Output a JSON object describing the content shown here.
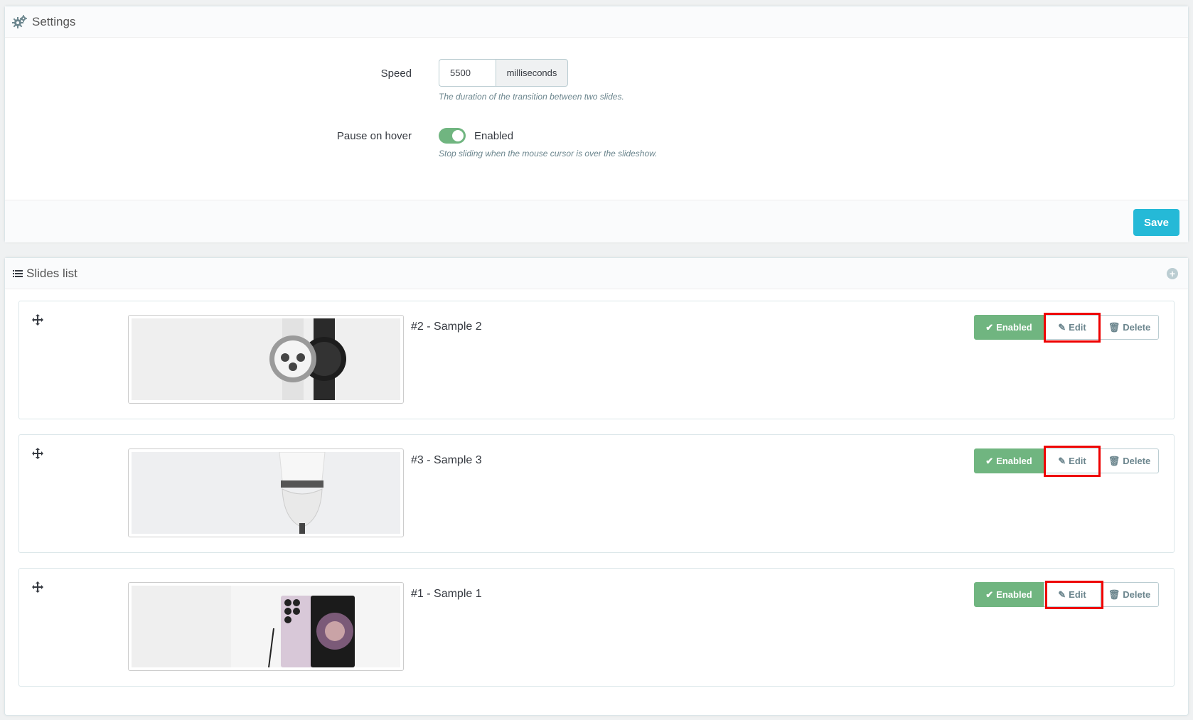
{
  "settings": {
    "title": "Settings",
    "speed_label": "Speed",
    "speed_value": "5500",
    "speed_unit": "milliseconds",
    "speed_help": "The duration of the transition between two slides.",
    "pause_label": "Pause on hover",
    "pause_state": "Enabled",
    "pause_enabled": true,
    "pause_help": "Stop sliding when the mouse cursor is over the slideshow.",
    "save_label": "Save"
  },
  "slides": {
    "title": "Slides list",
    "items": [
      {
        "title": "#2 - Sample 2",
        "status": "Enabled",
        "edit": "Edit",
        "delete": "Delete",
        "image": "smartwatch-image"
      },
      {
        "title": "#3 - Sample 3",
        "status": "Enabled",
        "edit": "Edit",
        "delete": "Delete",
        "image": "speaker-image"
      },
      {
        "title": "#1 - Sample 1",
        "status": "Enabled",
        "edit": "Edit",
        "delete": "Delete",
        "image": "smartphone-image"
      }
    ]
  },
  "colors": {
    "accent": "#25b9d7",
    "enabled": "#70b580",
    "highlight": "#e00000"
  }
}
